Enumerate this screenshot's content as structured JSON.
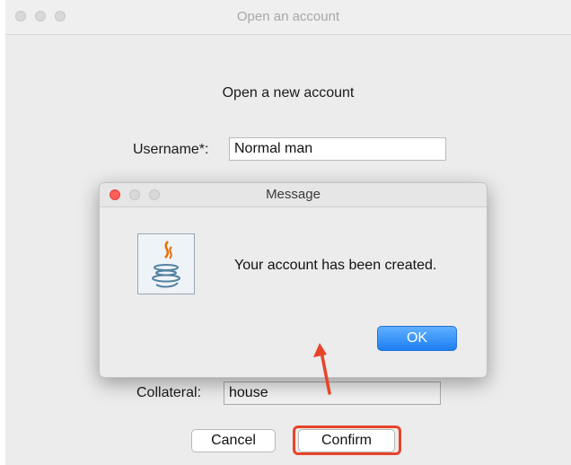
{
  "window": {
    "title": "Open an account"
  },
  "form": {
    "heading": "Open a new account",
    "username_label": "Username*:",
    "username_value": "Normal man",
    "collateral_label": "Collateral:",
    "collateral_value": "house",
    "cancel_label": "Cancel",
    "confirm_label": "Confirm"
  },
  "dialog": {
    "title": "Message",
    "message": "Your account has been created.",
    "ok_label": "OK",
    "icon": "java-icon"
  },
  "colors": {
    "highlight": "#e8442a",
    "ok_button": "#1d7df2",
    "close_red": "#fe5f57",
    "minimize_yellow": "#d8d8d8",
    "zoom_green": "#d8d8d8"
  }
}
